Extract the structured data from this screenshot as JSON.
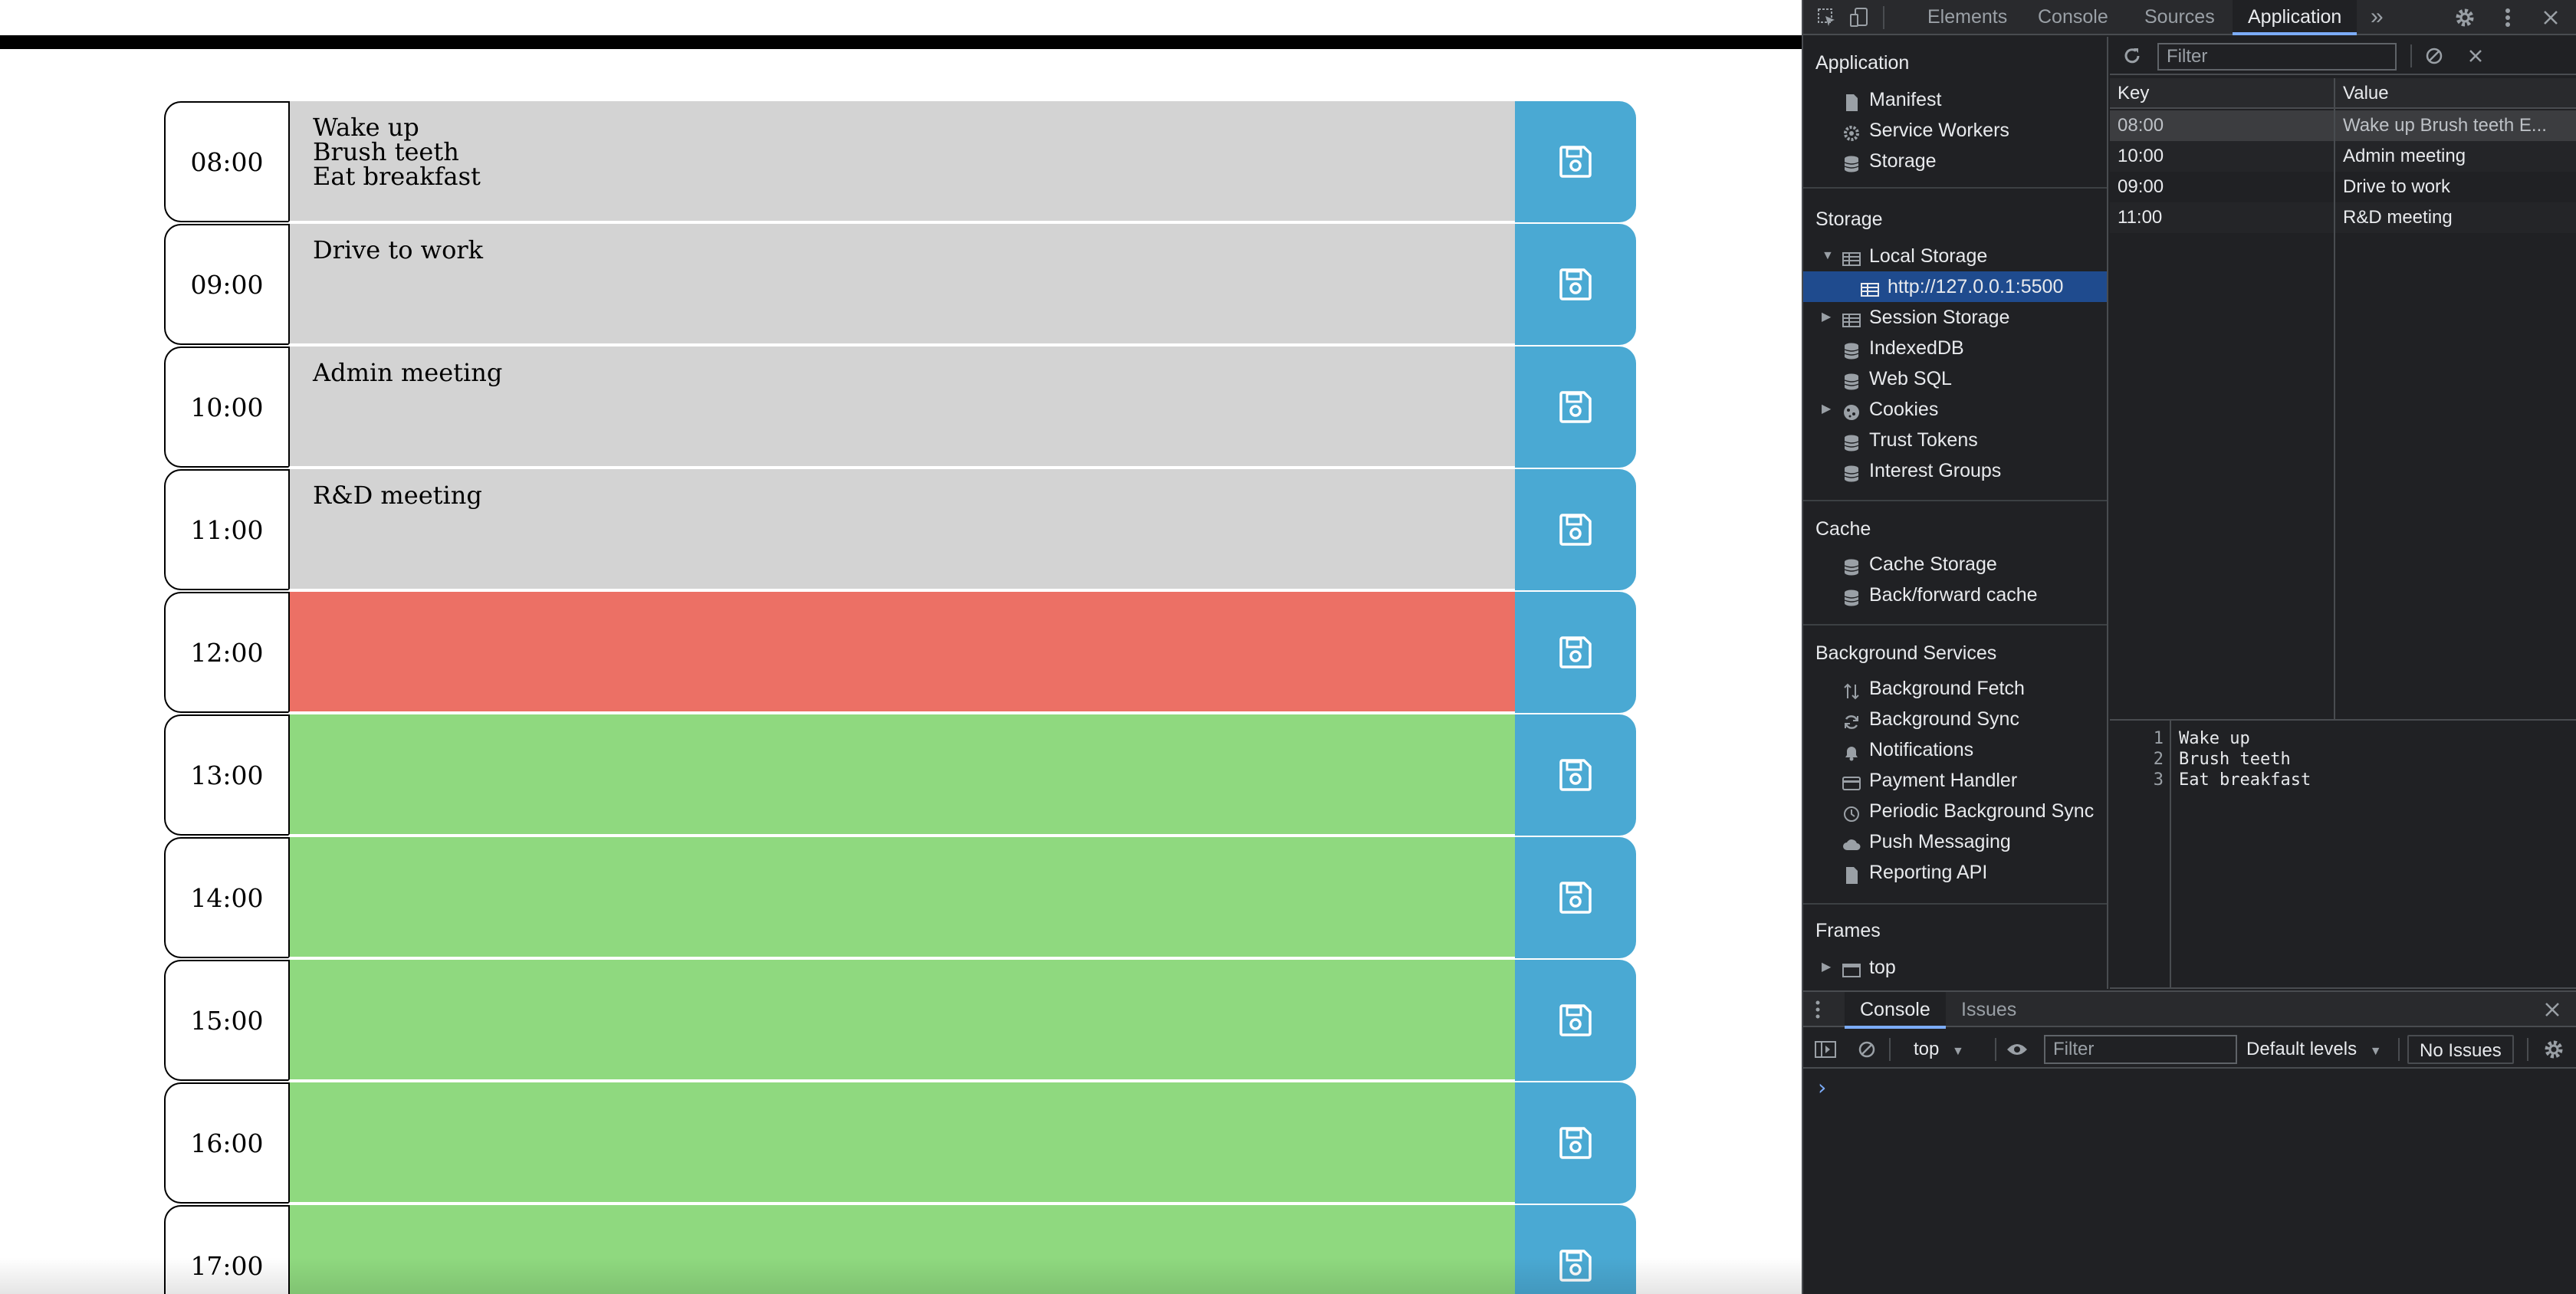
{
  "scheduler": {
    "rows": [
      {
        "hour": "08:00",
        "text": "Wake up\nBrush teeth\nEat breakfast",
        "state": "past"
      },
      {
        "hour": "09:00",
        "text": "Drive to work",
        "state": "past"
      },
      {
        "hour": "10:00",
        "text": "Admin meeting",
        "state": "past"
      },
      {
        "hour": "11:00",
        "text": "R&D meeting",
        "state": "past"
      },
      {
        "hour": "12:00",
        "text": "",
        "state": "present"
      },
      {
        "hour": "13:00",
        "text": "",
        "state": "future"
      },
      {
        "hour": "14:00",
        "text": "",
        "state": "future"
      },
      {
        "hour": "15:00",
        "text": "",
        "state": "future"
      },
      {
        "hour": "16:00",
        "text": "",
        "state": "future"
      },
      {
        "hour": "17:00",
        "text": "",
        "state": "future"
      }
    ],
    "colors": {
      "past": "#d3d3d3",
      "present": "#ec7065",
      "future": "#8fd97f",
      "save": "#4aa9d3"
    },
    "save_icon": "floppy-disk-icon"
  },
  "devtools": {
    "tabs": [
      "Elements",
      "Console",
      "Sources",
      "Application"
    ],
    "active_tab": "Application",
    "more_tabs_label": "»",
    "sidebar": {
      "application": {
        "header": "Application",
        "items": [
          "Manifest",
          "Service Workers",
          "Storage"
        ]
      },
      "storage": {
        "header": "Storage",
        "local_storage": "Local Storage",
        "origin": "http://127.0.0.1:5500",
        "items": [
          "Session Storage",
          "IndexedDB",
          "Web SQL",
          "Cookies",
          "Trust Tokens",
          "Interest Groups"
        ]
      },
      "cache": {
        "header": "Cache",
        "items": [
          "Cache Storage",
          "Back/forward cache"
        ]
      },
      "background": {
        "header": "Background Services",
        "items": [
          "Background Fetch",
          "Background Sync",
          "Notifications",
          "Payment Handler",
          "Periodic Background Sync",
          "Push Messaging",
          "Reporting API"
        ]
      },
      "frames": {
        "header": "Frames",
        "items": [
          "top"
        ]
      }
    },
    "storage_filter_placeholder": "Filter",
    "table": {
      "headers": [
        "Key",
        "Value"
      ],
      "rows": [
        {
          "key": "08:00",
          "value": "Wake up Brush teeth E..."
        },
        {
          "key": "10:00",
          "value": "Admin meeting"
        },
        {
          "key": "09:00",
          "value": "Drive to work"
        },
        {
          "key": "11:00",
          "value": "R&D meeting"
        }
      ]
    },
    "preview": {
      "lines": [
        "Wake up",
        "Brush teeth",
        "Eat breakfast"
      ]
    },
    "drawer": {
      "tabs": [
        "Console",
        "Issues"
      ],
      "active_tab": "Console",
      "context": "top",
      "filter_placeholder": "Filter",
      "levels": "Default levels",
      "issues": "No Issues",
      "prompt": "›"
    }
  }
}
